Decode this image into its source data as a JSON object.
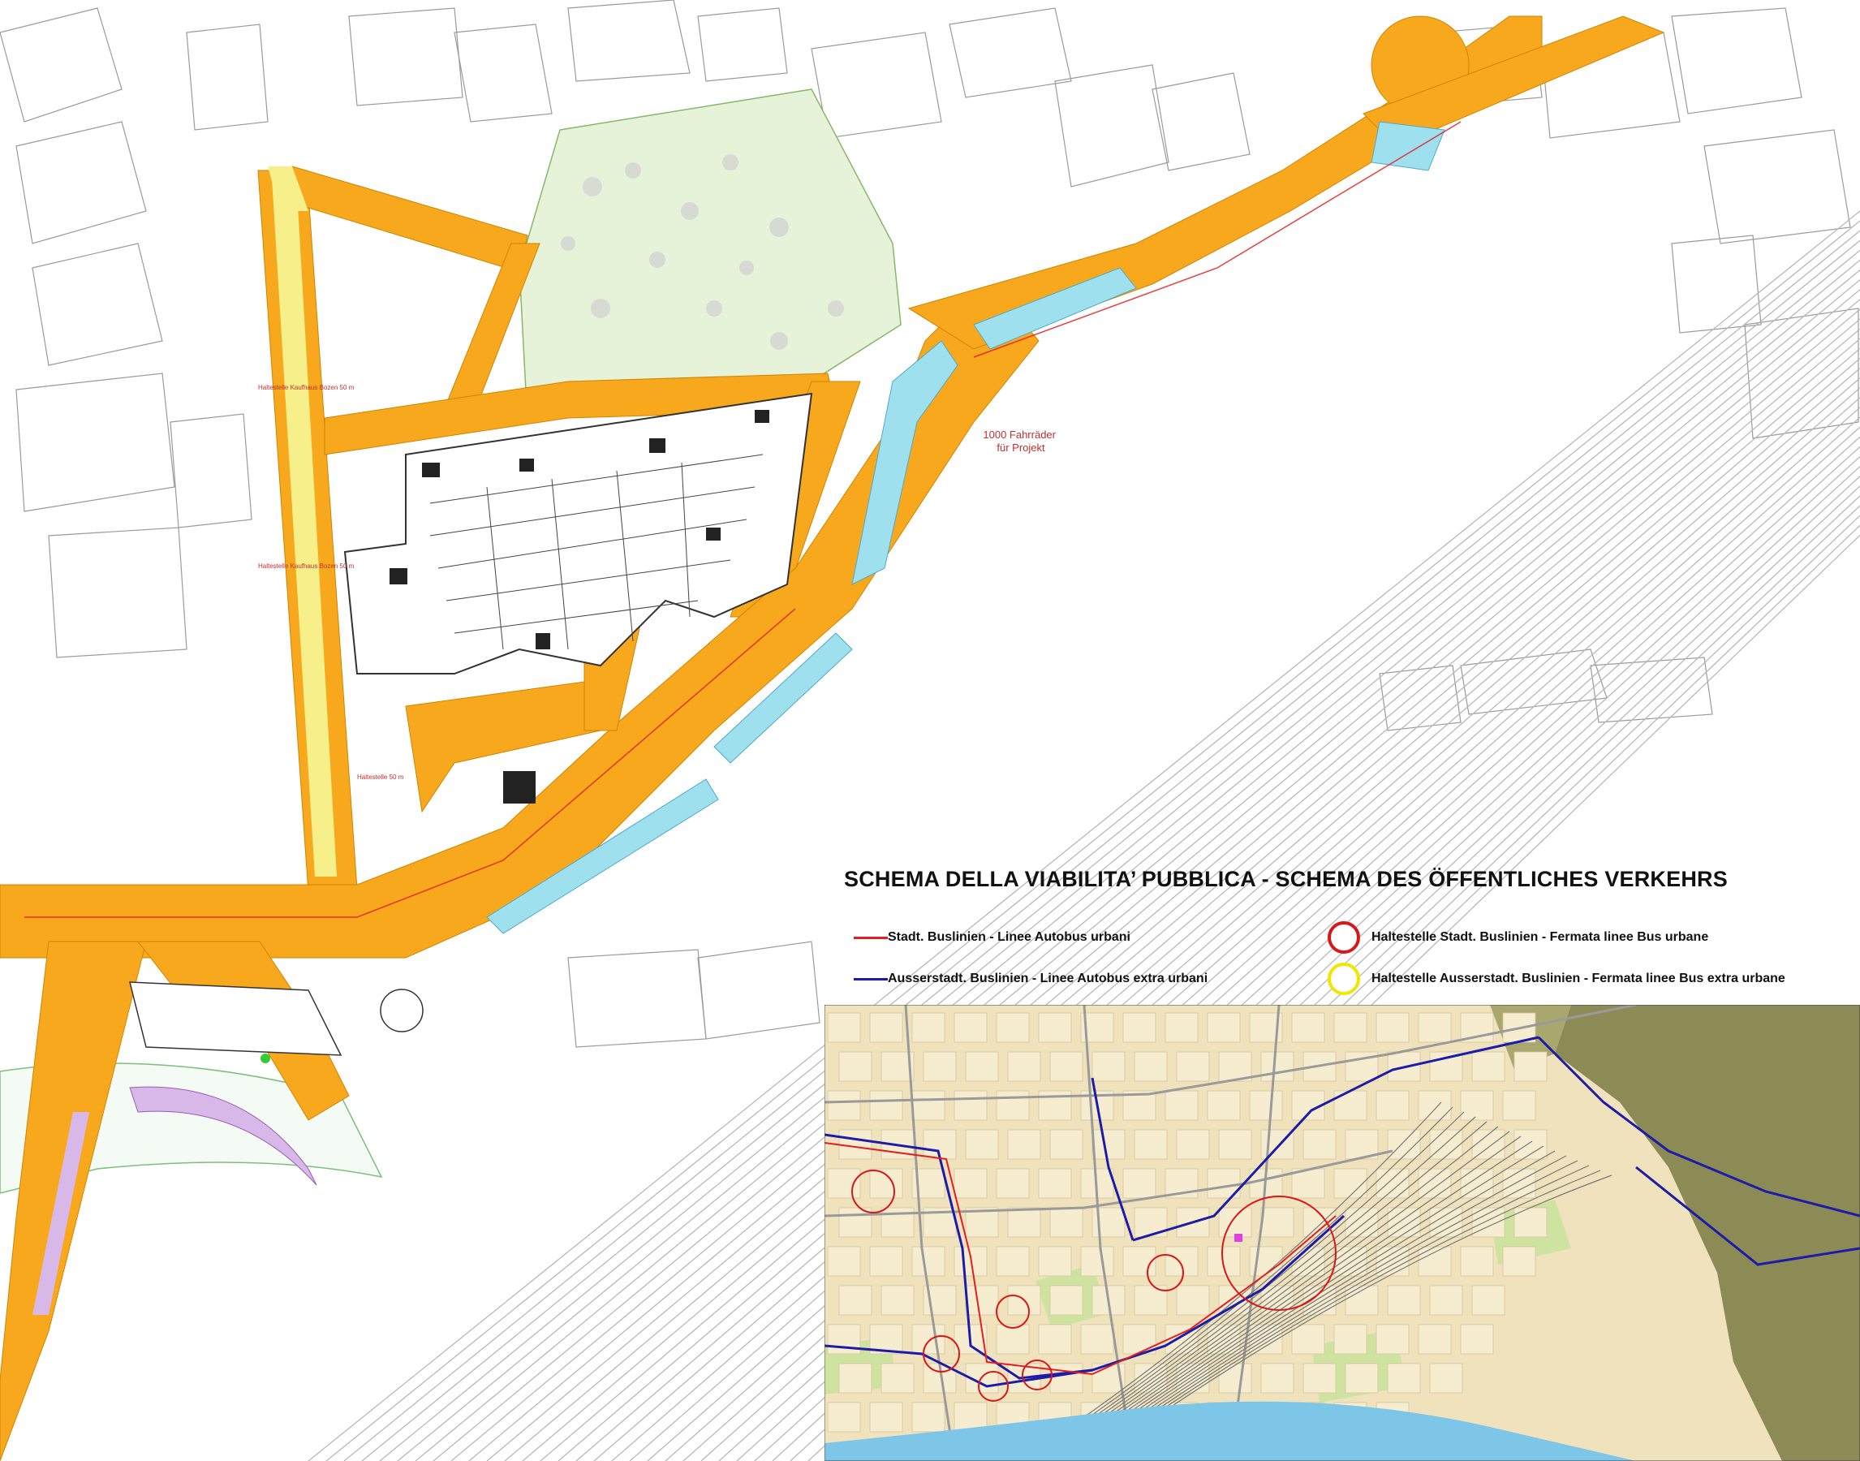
{
  "legend": {
    "title": "SCHEMA DELLA VIABILITA’ PUBBLICA -  SCHEMA DES ÖFFENTLICHES VERKEHRS",
    "items": [
      {
        "symbol": "line",
        "color": "#e02020",
        "label": "Stadt. Buslinien - Linee Autobus urbani"
      },
      {
        "symbol": "line",
        "color": "#1c1ca8",
        "label": "Ausserstadt. Buslinien -  Linee Autobus extra urbani"
      },
      {
        "symbol": "circle",
        "color": "#d81818",
        "label": "Haltestelle Stadt. Buslinien - Fermata linee Bus urbane"
      },
      {
        "symbol": "circle",
        "color": "#f2e600",
        "label": "Haltestelle Ausserstadt. Buslinien -  Fermata linee Bus extra urbane"
      }
    ]
  },
  "plan": {
    "bike_note": "1000 Fahrräder\nfür Projekt",
    "stop_labels": [
      "Haltestelle Kaufhaus Bozen 50 m",
      "Haltestelle Kaufhaus Bozen 50 m",
      "Haltestelle 50 m"
    ],
    "colors": {
      "road_orange": "#f7a81c",
      "pedestrian_yellow": "#f7ef8a",
      "water_blue": "#9fe0ee",
      "park_green": "#e6f3d8",
      "building_outline": "#333333",
      "bus_red": "#e02020",
      "bus_blue": "#1c1ca8"
    }
  },
  "inset_map": {
    "colors": {
      "urban": "#efe2bd",
      "green": "#cfe3a0",
      "forest": "#8c8a55",
      "rail": "#777777",
      "river": "#7ec6e8"
    }
  }
}
